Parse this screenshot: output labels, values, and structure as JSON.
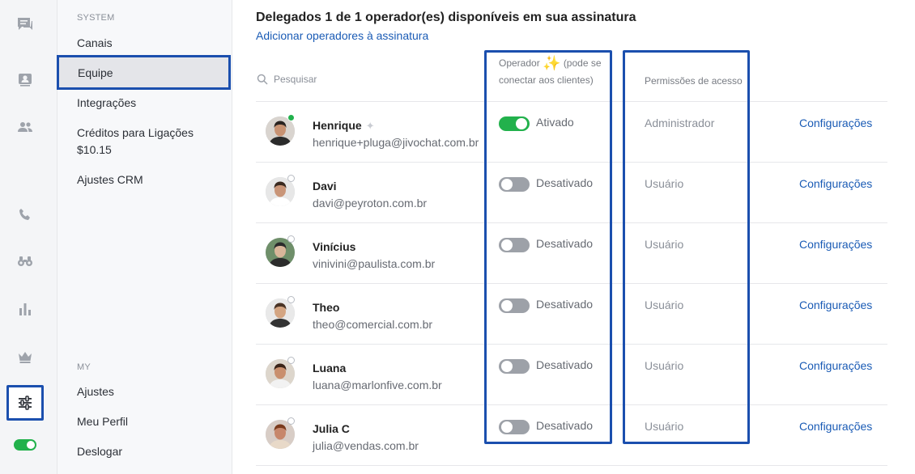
{
  "rail": {
    "icons": [
      "chat-icon",
      "contacts-card-icon",
      "team-icon",
      "phone-icon",
      "binoculars-icon",
      "bar-chart-icon",
      "crown-icon",
      "sliders-icon"
    ],
    "status_toggle_on": true
  },
  "nav": {
    "section_system": "SYSTEM",
    "items": [
      {
        "label": "Canais"
      },
      {
        "label": "Equipe"
      },
      {
        "label": "Integrações"
      },
      {
        "label": "Créditos para Ligações $10.15"
      },
      {
        "label": "Ajustes CRM"
      }
    ],
    "section_my": "MY",
    "my_items": [
      {
        "label": "Ajustes"
      },
      {
        "label": "Meu Perfil"
      },
      {
        "label": "Deslogar"
      }
    ]
  },
  "main": {
    "headline": "Delegados 1 de 1 operador(es) disponíveis em sua assinatura",
    "add_link": "Adicionar operadores à assinatura",
    "search_placeholder": "Pesquisar",
    "col_operator_a": "Operador",
    "col_operator_b": "(pode se",
    "col_operator_c": "conectar aos clientes)",
    "col_permissions": "Permissões de acesso",
    "operators": [
      {
        "name": "Henrique",
        "email": "henrique+pluga@jivochat.com.br",
        "status": "Ativado",
        "permission": "Administrador",
        "action": "Configurações"
      },
      {
        "name": "Davi",
        "email": "davi@peyroton.com.br",
        "status": "Desativado",
        "permission": "Usuário",
        "action": "Configurações"
      },
      {
        "name": "Vinícius",
        "email": "vinivini@paulista.com.br",
        "status": "Desativado",
        "permission": "Usuário",
        "action": "Configurações"
      },
      {
        "name": "Theo",
        "email": "theo@comercial.com.br",
        "status": "Desativado",
        "permission": "Usuário",
        "action": "Configurações"
      },
      {
        "name": "Luana",
        "email": "luana@marlonfive.com.br",
        "status": "Desativado",
        "permission": "Usuário",
        "action": "Configurações"
      },
      {
        "name": "Julia C",
        "email": "julia@vendas.com.br",
        "status": "Desativado",
        "permission": "Usuário",
        "action": "Configurações"
      }
    ]
  },
  "colors": {
    "accent": "#1a5bb5",
    "highlight": "#1b4fae",
    "enabled": "#22b14c",
    "disabled": "#9da1a8"
  }
}
